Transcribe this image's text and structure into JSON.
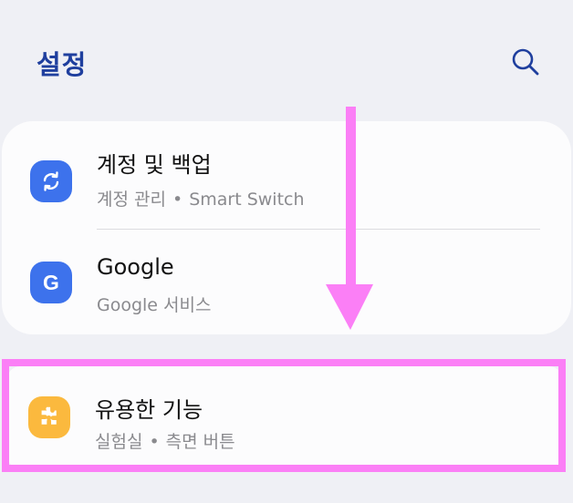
{
  "header": {
    "title": "설정",
    "search_icon": "search-icon"
  },
  "colors": {
    "background": "#eff0f5",
    "card": "#fcfcfd",
    "title": "#1f3f9e",
    "icon_blue": "#3d72ec",
    "icon_orange": "#fbb93e",
    "annotation": "#fb7ff6"
  },
  "settings": {
    "items": [
      {
        "title": "계정 및 백업",
        "subtitle_parts": [
          "계정 관리",
          "Smart Switch"
        ],
        "icon": "sync-icon"
      },
      {
        "title": "Google",
        "subtitle_parts": [
          "Google 서비스"
        ],
        "icon": "google-g-icon"
      },
      {
        "title": "유용한 기능",
        "subtitle_parts": [
          "실험실",
          "측면 버튼"
        ],
        "icon": "puzzle-icon"
      }
    ],
    "separator": "•"
  },
  "annotation": {
    "type": "scroll-down-arrow",
    "highlighted_item": "유용한 기능"
  }
}
